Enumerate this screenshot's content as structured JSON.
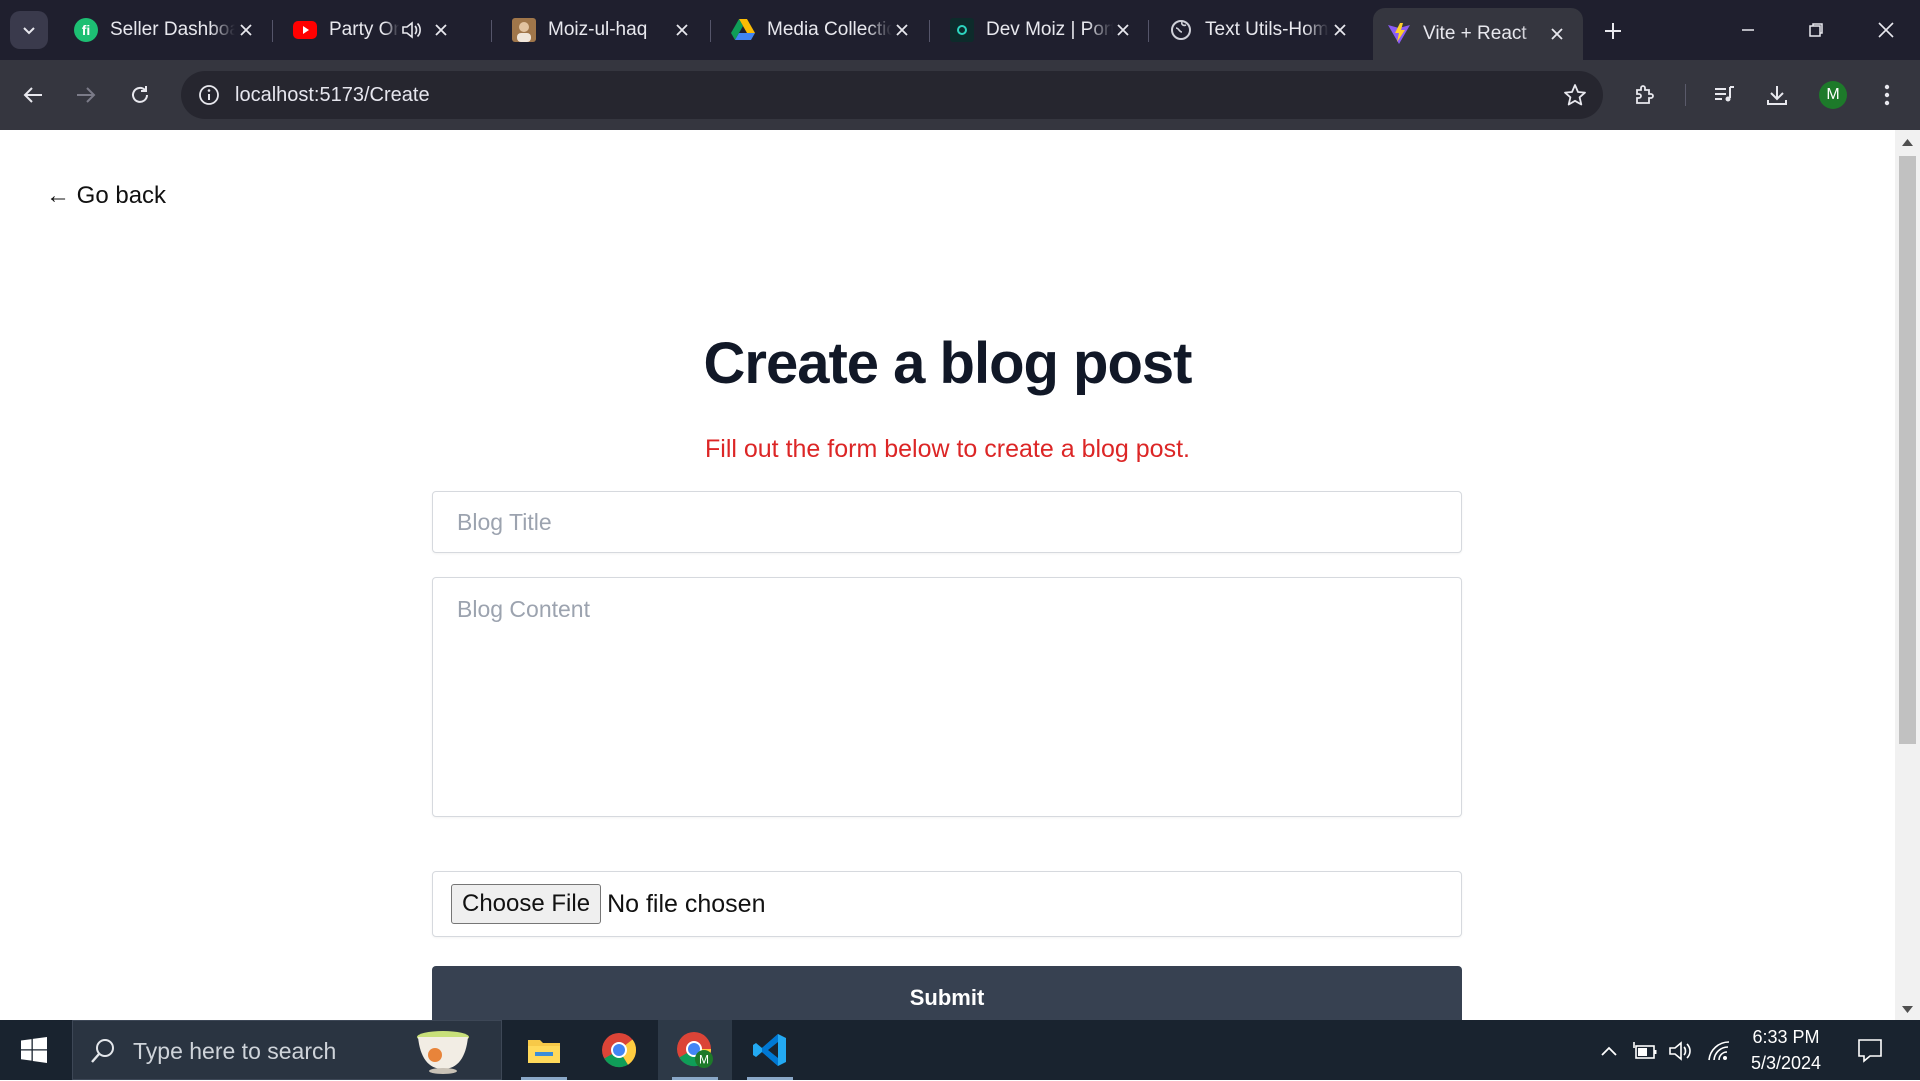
{
  "browser": {
    "tabs": [
      {
        "title": "Seller Dashboard",
        "icon": "fiverr-icon"
      },
      {
        "title": "Party On My Mind",
        "icon": "youtube-icon",
        "audio": true
      },
      {
        "title": "Moiz-ul-haq",
        "icon": "profile-photo-icon"
      },
      {
        "title": "Media Collection",
        "icon": "google-drive-icon"
      },
      {
        "title": "Dev Moiz | Portfolio",
        "icon": "dev-site-icon"
      },
      {
        "title": "Text Utils-Home",
        "icon": "globe-icon"
      },
      {
        "title": "Vite + React",
        "icon": "vite-icon",
        "active": true
      }
    ],
    "url": "localhost:5173/Create",
    "profile_initial": "M"
  },
  "page": {
    "back_link": "← Go back",
    "title": "Create a blog post",
    "subtitle": "Fill out the form below to create a blog post.",
    "form": {
      "title_placeholder": "Blog Title",
      "content_placeholder": "Blog Content",
      "choose_file_label": "Choose File",
      "file_status": "No file chosen",
      "submit_label": "Submit"
    }
  },
  "taskbar": {
    "search_placeholder": "Type here to search",
    "time": "6:33 PM",
    "date": "5/3/2024",
    "apps": [
      "file-explorer-icon",
      "chrome-icon",
      "chrome-profile-icon",
      "vscode-icon"
    ]
  },
  "colors": {
    "title": "#111827",
    "subtitle": "#dc2626",
    "submit_bg": "#374151",
    "tabstrip_bg": "#1f1f2e",
    "toolbar_bg": "#35363f",
    "taskbar_bg": "#19232f"
  }
}
